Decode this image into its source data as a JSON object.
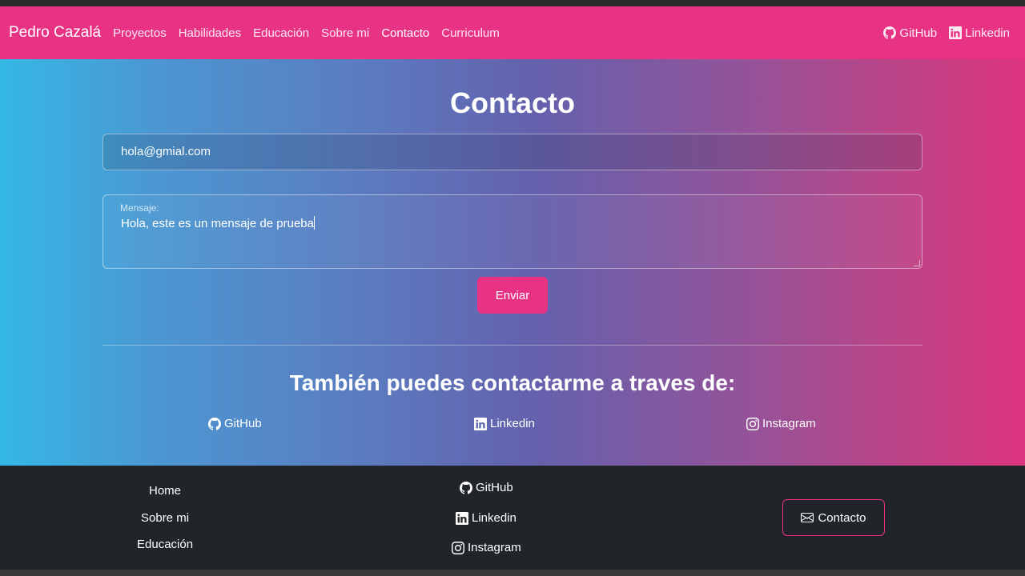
{
  "navbar": {
    "brand": "Pedro Cazalá",
    "links": [
      {
        "label": "Proyectos"
      },
      {
        "label": "Habilidades"
      },
      {
        "label": "Educación"
      },
      {
        "label": "Sobre mi"
      },
      {
        "label": "Contacto"
      },
      {
        "label": "Curriculum"
      }
    ],
    "active_link": "Contacto",
    "github_label": "GitHub",
    "linkedin_label": "Linkedin"
  },
  "contact": {
    "title": "Contacto",
    "email_value": "hola@gmial.com",
    "message_label": "Mensaje:",
    "message_value": "Hola, este es un mensaje de prueba",
    "send_label": "Enviar"
  },
  "alternatives": {
    "title": "También puedes contactarme a traves de:",
    "github_label": "GitHub",
    "linkedin_label": "Linkedin",
    "instagram_label": "Instagram"
  },
  "footer": {
    "home_label": "Home",
    "about_label": "Sobre mi",
    "education_label": "Educación",
    "github_label": "GitHub",
    "linkedin_label": "Linkedin",
    "instagram_label": "Instagram",
    "contact_label": "Contacto"
  },
  "colors": {
    "accent": "#e83385",
    "footer_bg": "#212529",
    "gradient_start": "#34b8e5",
    "gradient_end": "#de3580"
  },
  "icons": [
    "github-icon",
    "linkedin-icon",
    "instagram-icon",
    "envelope-icon"
  ]
}
